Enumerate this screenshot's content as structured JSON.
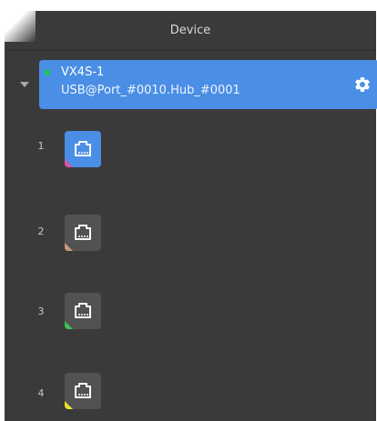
{
  "panel": {
    "title": "Device"
  },
  "device": {
    "name": "VX4S-1",
    "connection": "USB@Port_#0010.Hub_#0001",
    "status_color": "#22c55e",
    "settings_icon": "gear-icon",
    "expanded": true
  },
  "ports": [
    {
      "number": "1",
      "active": true,
      "icon": "ethernet-port-icon",
      "marker_color": "#d7559b"
    },
    {
      "number": "2",
      "active": false,
      "icon": "ethernet-port-icon",
      "marker_color": "#c99a7a"
    },
    {
      "number": "3",
      "active": false,
      "icon": "ethernet-port-icon",
      "marker_color": "#3ec25b"
    },
    {
      "number": "4",
      "active": false,
      "icon": "ethernet-port-icon",
      "marker_color": "#e8e02a"
    }
  ],
  "colors": {
    "panel_bg": "#3a3a3a",
    "accent": "#4a8ee5",
    "port_bg": "#525252"
  }
}
